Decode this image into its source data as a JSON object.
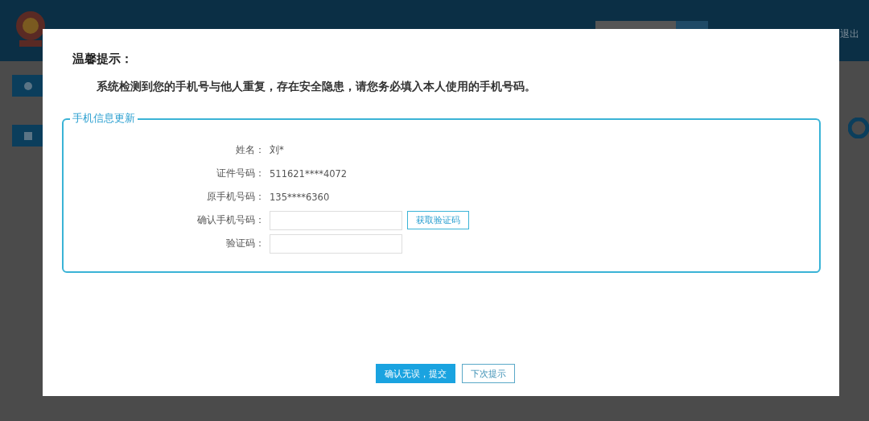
{
  "header": {
    "logout": "退出"
  },
  "dialog": {
    "title": "温馨提示：",
    "message": "系统检测到您的手机号与他人重复，存在安全隐患，请您务必填入本人使用的手机号码。",
    "section": {
      "legend": "手机信息更新",
      "rows": [
        {
          "kind": "text",
          "label": "姓名：",
          "value": "刘*"
        },
        {
          "kind": "text",
          "label": "证件号码：",
          "value": "511621****4072"
        },
        {
          "kind": "text",
          "label": "原手机号码：",
          "value": "135****6360"
        },
        {
          "kind": "input",
          "label": "确认手机号码：",
          "action": "获取验证码"
        },
        {
          "kind": "input",
          "label": "验证码："
        }
      ]
    },
    "buttons": [
      {
        "label": "确认无误，提交",
        "primary": true
      },
      {
        "label": "下次提示",
        "primary": false
      }
    ]
  }
}
